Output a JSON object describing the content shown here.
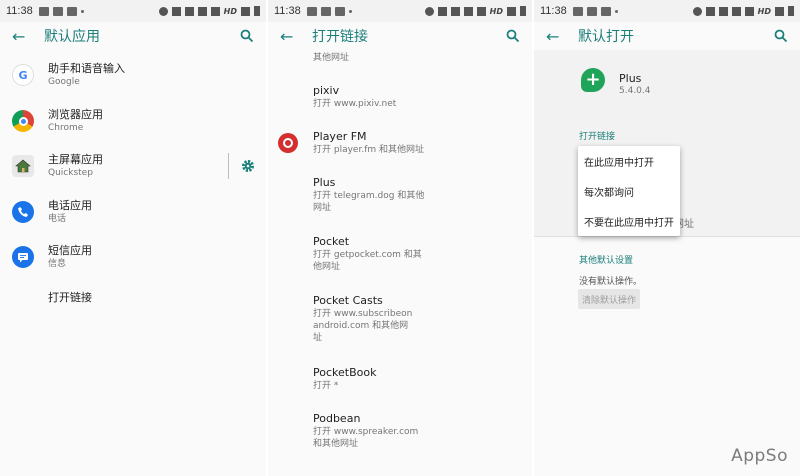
{
  "status": {
    "time": "11:38",
    "network": "HD"
  },
  "panel1": {
    "title": "默认应用",
    "items": [
      {
        "title": "助手和语音输入",
        "subtitle": "Google",
        "icon": "google-icon"
      },
      {
        "title": "浏览器应用",
        "subtitle": "Chrome",
        "icon": "chrome-icon"
      },
      {
        "title": "主屏幕应用",
        "subtitle": "Quickstep",
        "icon": "home-icon"
      },
      {
        "title": "电话应用",
        "subtitle": "电话",
        "icon": "phone-icon"
      },
      {
        "title": "短信应用",
        "subtitle": "信息",
        "icon": "messages-icon"
      },
      {
        "title": "打开链接",
        "subtitle": "",
        "icon": ""
      }
    ]
  },
  "panel2": {
    "title": "打开链接",
    "top_partial": "其他网址",
    "items": [
      {
        "title": "pixiv",
        "sub1": "打开 www.pixiv.net",
        "sub2": ""
      },
      {
        "title": "Player FM",
        "sub1": "打开 player.fm 和其他网址",
        "sub2": ""
      },
      {
        "title": "Plus",
        "sub1": "打开 telegram.dog 和其他",
        "sub2": "网址"
      },
      {
        "title": "Pocket",
        "sub1": "打开 getpocket.com 和其",
        "sub2": "他网址"
      },
      {
        "title": "Pocket Casts",
        "sub1": "打开 www.subscribeon",
        "sub2": "android.com 和其他网",
        "sub3": "址"
      },
      {
        "title": "PocketBook",
        "sub1": "打开 *",
        "sub2": ""
      },
      {
        "title": "Podbean",
        "sub1": "打开 www.spreaker.com",
        "sub2": "和其他网址"
      }
    ]
  },
  "panel3": {
    "title": "默认打开",
    "app_name": "Plus",
    "app_version": "5.4.0.4",
    "open_links_header": "打开链接",
    "menu": [
      "在此应用中打开",
      "每次都询问",
      "不要在此应用中打开"
    ],
    "behind_text": "网址",
    "other_defaults_header": "其他默认设置",
    "no_defaults": "没有默认操作。",
    "clear_button": "清除默认操作"
  },
  "watermark": "AppSo",
  "colors": {
    "accent": "#1b7f7a",
    "plus_green": "#1fa45a"
  }
}
